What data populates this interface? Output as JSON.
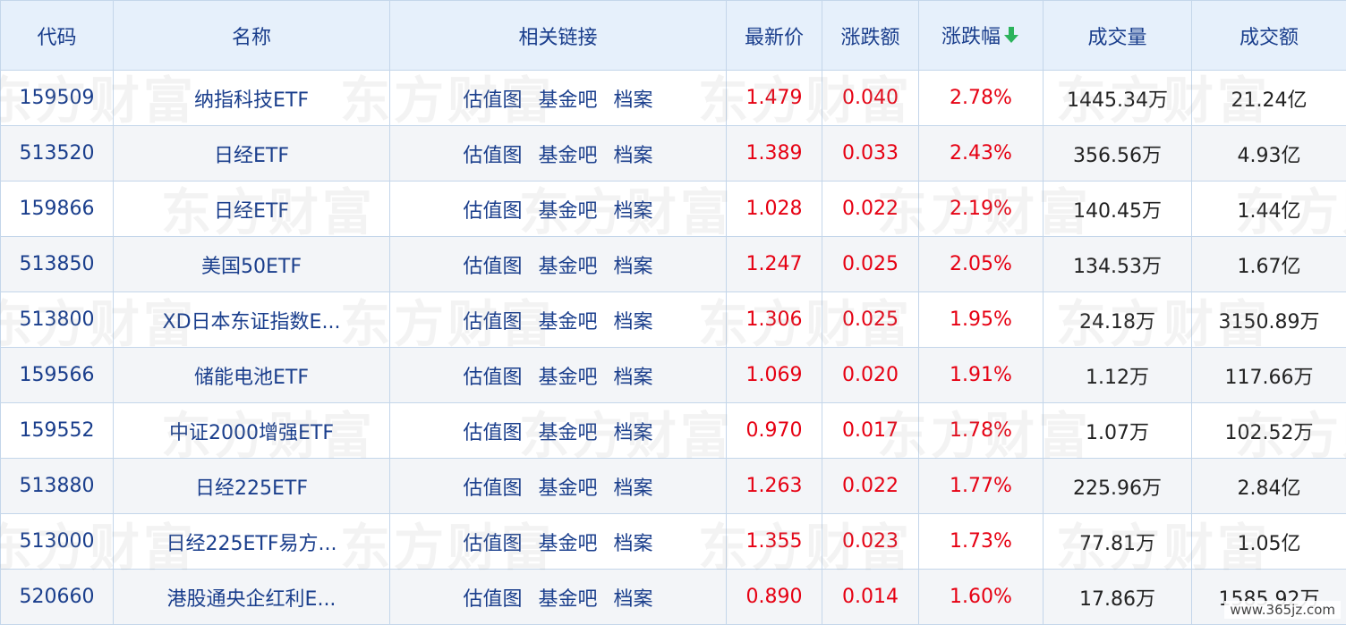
{
  "headers": {
    "code": "代码",
    "name": "名称",
    "links": "相关链接",
    "price": "最新价",
    "change": "涨跌额",
    "pct": "涨跌幅",
    "volume": "成交量",
    "amount": "成交额"
  },
  "sort_icon": "arrow-down-icon",
  "colors": {
    "up": "#e60012",
    "link": "#1a3e8c",
    "sort_arrow": "#2bb35b"
  },
  "link_labels": [
    "估值图",
    "基金吧",
    "档案"
  ],
  "rows": [
    {
      "code": "159509",
      "name": "纳指科技ETF",
      "price": "1.479",
      "change": "0.040",
      "pct": "2.78%",
      "volume": "1445.34万",
      "amount": "21.24亿"
    },
    {
      "code": "513520",
      "name": "日经ETF",
      "price": "1.389",
      "change": "0.033",
      "pct": "2.43%",
      "volume": "356.56万",
      "amount": "4.93亿"
    },
    {
      "code": "159866",
      "name": "日经ETF",
      "price": "1.028",
      "change": "0.022",
      "pct": "2.19%",
      "volume": "140.45万",
      "amount": "1.44亿"
    },
    {
      "code": "513850",
      "name": "美国50ETF",
      "price": "1.247",
      "change": "0.025",
      "pct": "2.05%",
      "volume": "134.53万",
      "amount": "1.67亿"
    },
    {
      "code": "513800",
      "name": "XD日本东证指数E...",
      "price": "1.306",
      "change": "0.025",
      "pct": "1.95%",
      "volume": "24.18万",
      "amount": "3150.89万"
    },
    {
      "code": "159566",
      "name": "储能电池ETF",
      "price": "1.069",
      "change": "0.020",
      "pct": "1.91%",
      "volume": "1.12万",
      "amount": "117.66万"
    },
    {
      "code": "159552",
      "name": "中证2000增强ETF",
      "price": "0.970",
      "change": "0.017",
      "pct": "1.78%",
      "volume": "1.07万",
      "amount": "102.52万"
    },
    {
      "code": "513880",
      "name": "日经225ETF",
      "price": "1.263",
      "change": "0.022",
      "pct": "1.77%",
      "volume": "225.96万",
      "amount": "2.84亿"
    },
    {
      "code": "513000",
      "name": "日经225ETF易方...",
      "price": "1.355",
      "change": "0.023",
      "pct": "1.73%",
      "volume": "77.81万",
      "amount": "1.05亿"
    },
    {
      "code": "520660",
      "name": "港股通央企红利E...",
      "price": "0.890",
      "change": "0.014",
      "pct": "1.60%",
      "volume": "17.86万",
      "amount": "1585.92万"
    }
  ],
  "watermark_text": "东方财富",
  "corner_watermark": "www.365jz.com"
}
